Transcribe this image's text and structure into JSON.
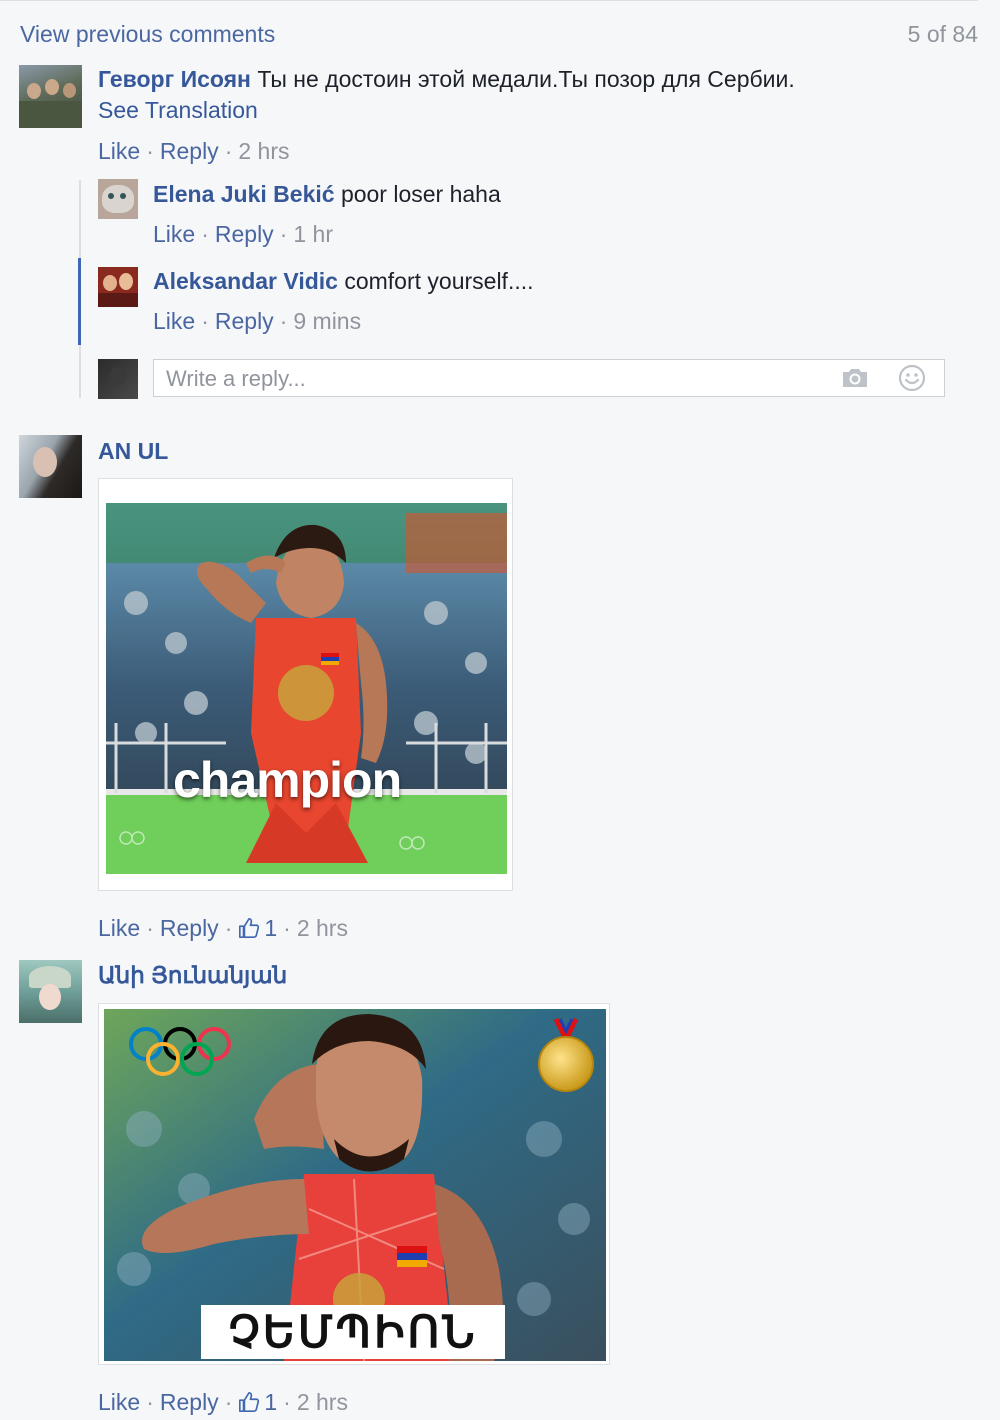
{
  "header": {
    "view_previous": "View previous comments",
    "counter": "5 of 84"
  },
  "comments": [
    {
      "author": "Геворг Исоян",
      "text": "Ты не достоин этой медали.Ты позор для Сербии.",
      "see_translation": "See Translation",
      "like": "Like",
      "reply": "Reply",
      "time": "2 hrs",
      "replies": [
        {
          "author": "Elena Juki Bekić",
          "text": "poor loser haha",
          "like": "Like",
          "reply": "Reply",
          "time": "1 hr"
        },
        {
          "author": "Aleksandar Vidic",
          "text": "comfort yourself....",
          "like": "Like",
          "reply": "Reply",
          "time": "9 mins"
        }
      ],
      "reply_input": {
        "placeholder": "Write a reply..."
      }
    },
    {
      "author": "AN UL",
      "image_caption": "champion",
      "like": "Like",
      "reply": "Reply",
      "reactions": "1",
      "time": "2 hrs"
    },
    {
      "author": "Անի Յունանյան",
      "image_caption": "ՉԵՄՊԻՈՆ",
      "like": "Like",
      "reply": "Reply",
      "reactions": "1",
      "time": "2 hrs"
    }
  ],
  "icons": [
    "camera-icon",
    "smiley-icon",
    "thumbs-up-icon"
  ],
  "colors": {
    "link": "#365899",
    "meta": "#90949c",
    "background": "#f6f7f9",
    "active_thread": "#4267b2"
  }
}
